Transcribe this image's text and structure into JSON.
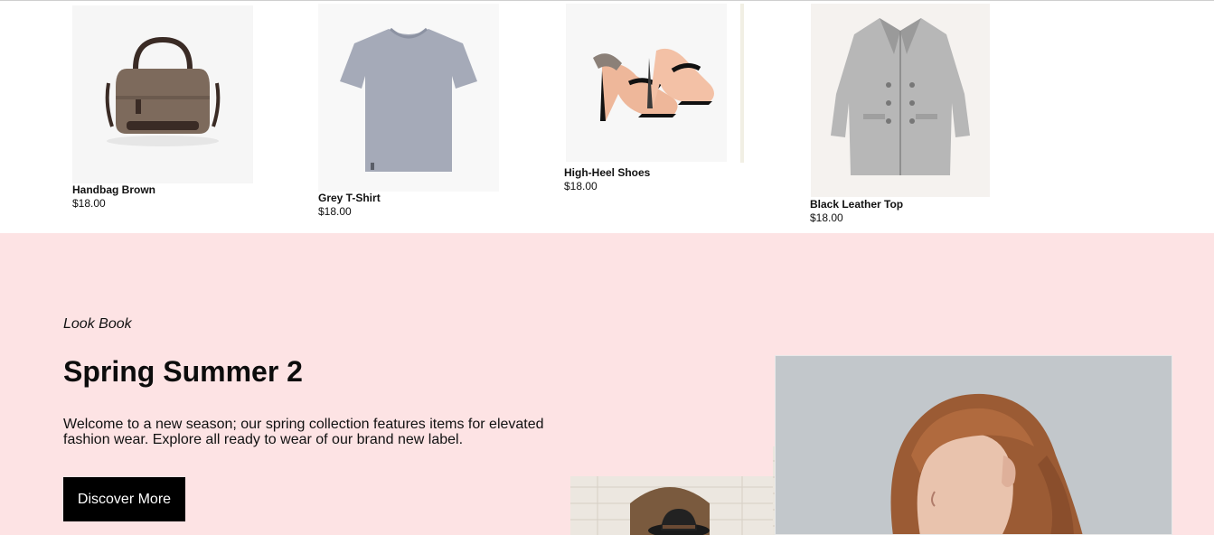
{
  "products": [
    {
      "name": "Handbag Brown",
      "price": "$18.00",
      "icon": "handbag-image"
    },
    {
      "name": "Grey T-Shirt",
      "price": "$18.00",
      "icon": "tshirt-image"
    },
    {
      "name": "High-Heel Shoes",
      "price": "$18.00",
      "icon": "heels-image"
    },
    {
      "name": "Black Leather Top",
      "price": "$18.00",
      "icon": "coat-image"
    }
  ],
  "lookbook": {
    "kicker": "Look Book",
    "title": "Spring Summer 2",
    "description": "Welcome to a new season; our spring collection features items for elevated fashion wear. Explore all ready to wear of our brand new label.",
    "button_label": "Discover More"
  },
  "colors": {
    "lookbook_bg": "#fde3e4",
    "button_bg": "#000000",
    "button_text": "#ffffff"
  }
}
